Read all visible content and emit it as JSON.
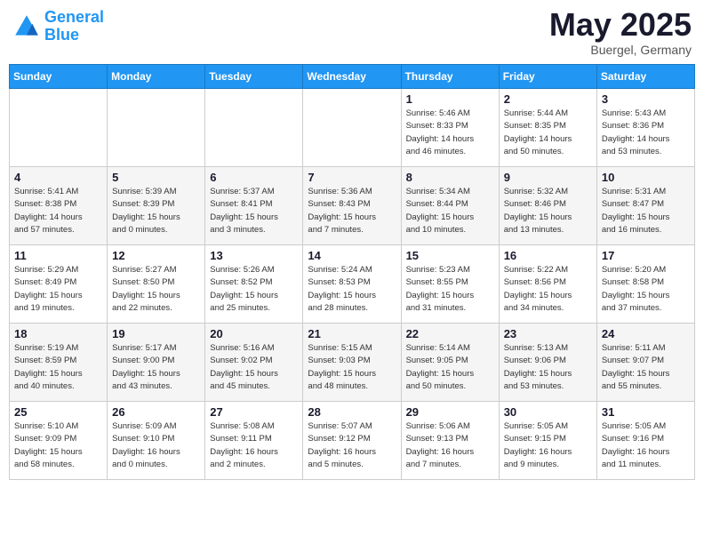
{
  "header": {
    "logo_line1": "General",
    "logo_line2": "Blue",
    "month": "May 2025",
    "location": "Buergel, Germany"
  },
  "days_of_week": [
    "Sunday",
    "Monday",
    "Tuesday",
    "Wednesday",
    "Thursday",
    "Friday",
    "Saturday"
  ],
  "weeks": [
    [
      {
        "day": "",
        "info": ""
      },
      {
        "day": "",
        "info": ""
      },
      {
        "day": "",
        "info": ""
      },
      {
        "day": "",
        "info": ""
      },
      {
        "day": "1",
        "info": "Sunrise: 5:46 AM\nSunset: 8:33 PM\nDaylight: 14 hours\nand 46 minutes."
      },
      {
        "day": "2",
        "info": "Sunrise: 5:44 AM\nSunset: 8:35 PM\nDaylight: 14 hours\nand 50 minutes."
      },
      {
        "day": "3",
        "info": "Sunrise: 5:43 AM\nSunset: 8:36 PM\nDaylight: 14 hours\nand 53 minutes."
      }
    ],
    [
      {
        "day": "4",
        "info": "Sunrise: 5:41 AM\nSunset: 8:38 PM\nDaylight: 14 hours\nand 57 minutes."
      },
      {
        "day": "5",
        "info": "Sunrise: 5:39 AM\nSunset: 8:39 PM\nDaylight: 15 hours\nand 0 minutes."
      },
      {
        "day": "6",
        "info": "Sunrise: 5:37 AM\nSunset: 8:41 PM\nDaylight: 15 hours\nand 3 minutes."
      },
      {
        "day": "7",
        "info": "Sunrise: 5:36 AM\nSunset: 8:43 PM\nDaylight: 15 hours\nand 7 minutes."
      },
      {
        "day": "8",
        "info": "Sunrise: 5:34 AM\nSunset: 8:44 PM\nDaylight: 15 hours\nand 10 minutes."
      },
      {
        "day": "9",
        "info": "Sunrise: 5:32 AM\nSunset: 8:46 PM\nDaylight: 15 hours\nand 13 minutes."
      },
      {
        "day": "10",
        "info": "Sunrise: 5:31 AM\nSunset: 8:47 PM\nDaylight: 15 hours\nand 16 minutes."
      }
    ],
    [
      {
        "day": "11",
        "info": "Sunrise: 5:29 AM\nSunset: 8:49 PM\nDaylight: 15 hours\nand 19 minutes."
      },
      {
        "day": "12",
        "info": "Sunrise: 5:27 AM\nSunset: 8:50 PM\nDaylight: 15 hours\nand 22 minutes."
      },
      {
        "day": "13",
        "info": "Sunrise: 5:26 AM\nSunset: 8:52 PM\nDaylight: 15 hours\nand 25 minutes."
      },
      {
        "day": "14",
        "info": "Sunrise: 5:24 AM\nSunset: 8:53 PM\nDaylight: 15 hours\nand 28 minutes."
      },
      {
        "day": "15",
        "info": "Sunrise: 5:23 AM\nSunset: 8:55 PM\nDaylight: 15 hours\nand 31 minutes."
      },
      {
        "day": "16",
        "info": "Sunrise: 5:22 AM\nSunset: 8:56 PM\nDaylight: 15 hours\nand 34 minutes."
      },
      {
        "day": "17",
        "info": "Sunrise: 5:20 AM\nSunset: 8:58 PM\nDaylight: 15 hours\nand 37 minutes."
      }
    ],
    [
      {
        "day": "18",
        "info": "Sunrise: 5:19 AM\nSunset: 8:59 PM\nDaylight: 15 hours\nand 40 minutes."
      },
      {
        "day": "19",
        "info": "Sunrise: 5:17 AM\nSunset: 9:00 PM\nDaylight: 15 hours\nand 43 minutes."
      },
      {
        "day": "20",
        "info": "Sunrise: 5:16 AM\nSunset: 9:02 PM\nDaylight: 15 hours\nand 45 minutes."
      },
      {
        "day": "21",
        "info": "Sunrise: 5:15 AM\nSunset: 9:03 PM\nDaylight: 15 hours\nand 48 minutes."
      },
      {
        "day": "22",
        "info": "Sunrise: 5:14 AM\nSunset: 9:05 PM\nDaylight: 15 hours\nand 50 minutes."
      },
      {
        "day": "23",
        "info": "Sunrise: 5:13 AM\nSunset: 9:06 PM\nDaylight: 15 hours\nand 53 minutes."
      },
      {
        "day": "24",
        "info": "Sunrise: 5:11 AM\nSunset: 9:07 PM\nDaylight: 15 hours\nand 55 minutes."
      }
    ],
    [
      {
        "day": "25",
        "info": "Sunrise: 5:10 AM\nSunset: 9:09 PM\nDaylight: 15 hours\nand 58 minutes."
      },
      {
        "day": "26",
        "info": "Sunrise: 5:09 AM\nSunset: 9:10 PM\nDaylight: 16 hours\nand 0 minutes."
      },
      {
        "day": "27",
        "info": "Sunrise: 5:08 AM\nSunset: 9:11 PM\nDaylight: 16 hours\nand 2 minutes."
      },
      {
        "day": "28",
        "info": "Sunrise: 5:07 AM\nSunset: 9:12 PM\nDaylight: 16 hours\nand 5 minutes."
      },
      {
        "day": "29",
        "info": "Sunrise: 5:06 AM\nSunset: 9:13 PM\nDaylight: 16 hours\nand 7 minutes."
      },
      {
        "day": "30",
        "info": "Sunrise: 5:05 AM\nSunset: 9:15 PM\nDaylight: 16 hours\nand 9 minutes."
      },
      {
        "day": "31",
        "info": "Sunrise: 5:05 AM\nSunset: 9:16 PM\nDaylight: 16 hours\nand 11 minutes."
      }
    ]
  ]
}
